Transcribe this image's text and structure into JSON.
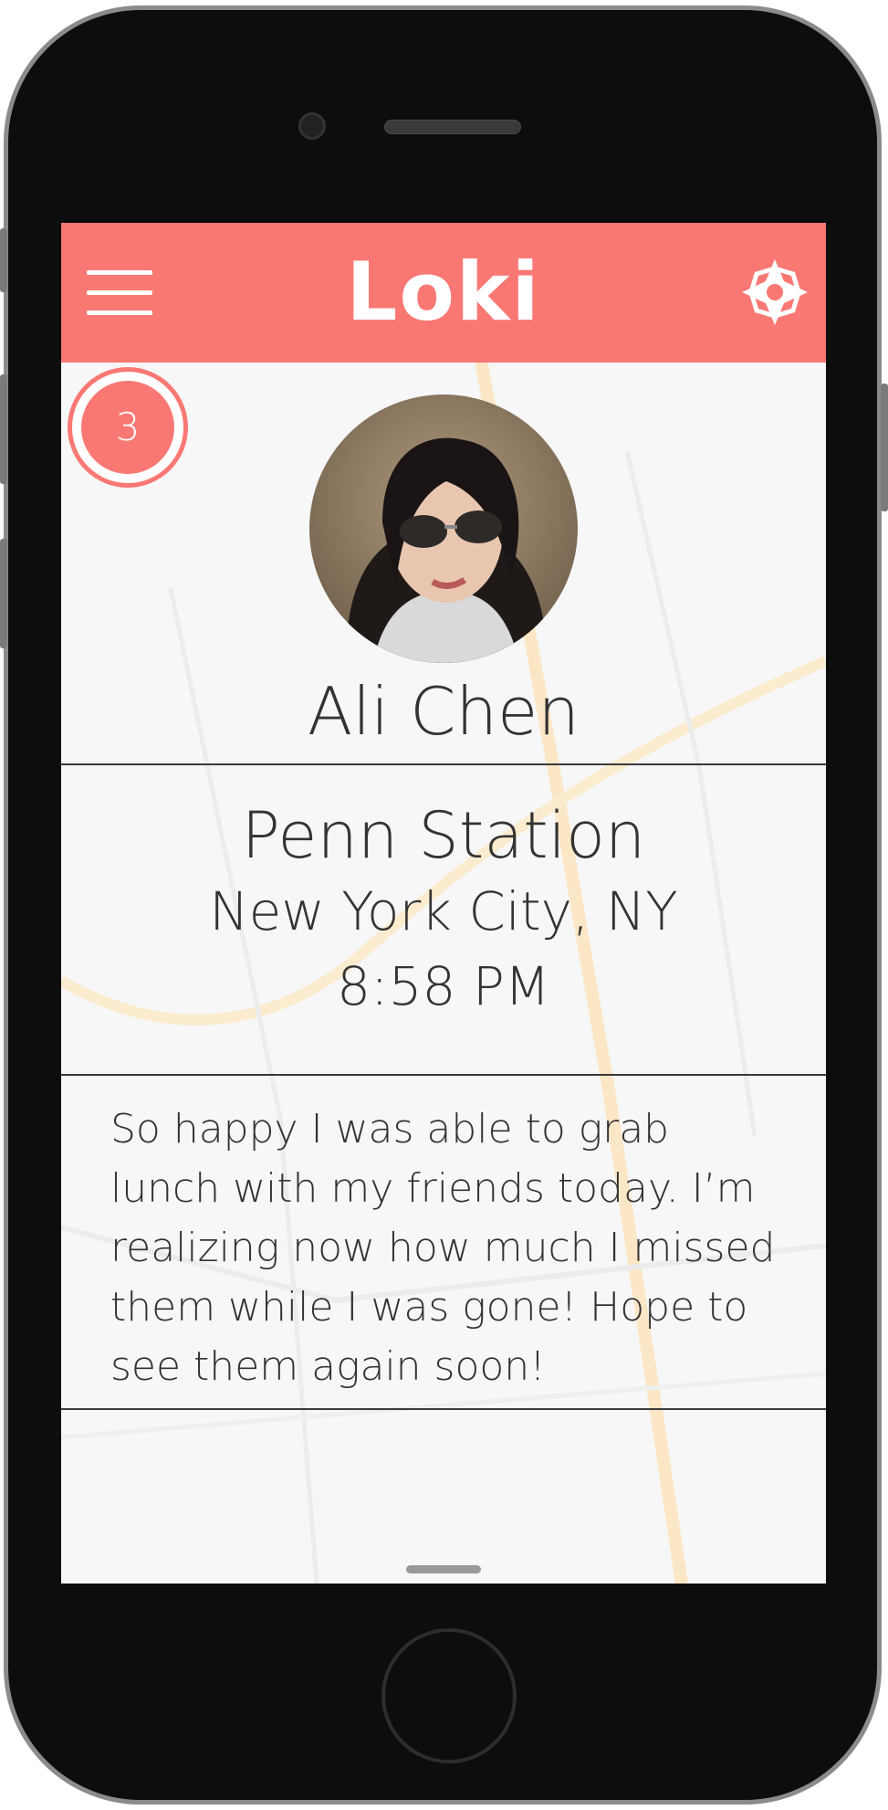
{
  "app": {
    "title": "Loki"
  },
  "header": {
    "menu_icon": "hamburger-menu-icon",
    "compass_icon": "compass-star-icon"
  },
  "counter": {
    "value": "3"
  },
  "profile": {
    "name": "Ali Chen"
  },
  "location": {
    "place": "Penn Station",
    "city": "New York City, NY",
    "time": "8:58 PM"
  },
  "post": {
    "text": "So happy I was able to grab lunch with my friends today. I’m realizing now how much I missed them while I was gone! Hope to see them again soon!"
  },
  "colors": {
    "accent": "#fa7874",
    "text": "#333333",
    "background": "#f7f7f7"
  }
}
